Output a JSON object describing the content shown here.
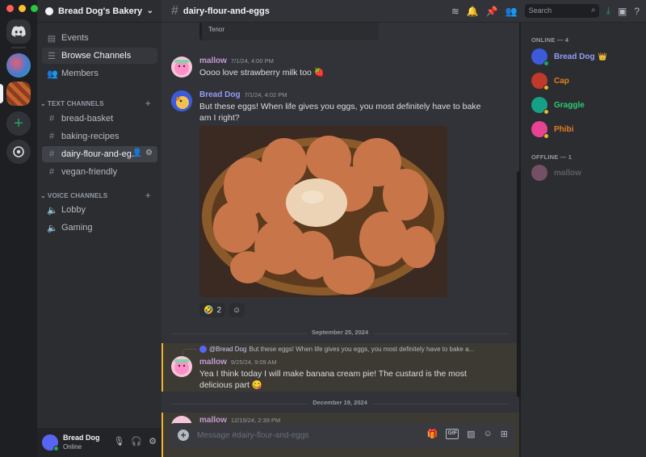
{
  "server": {
    "name": "Bread Dog's Bakery"
  },
  "sidebar": {
    "top_items": [
      {
        "label": "Events",
        "icon": "calendar-icon"
      },
      {
        "label": "Browse Channels",
        "icon": "browse-channels-icon"
      },
      {
        "label": "Members",
        "icon": "members-icon"
      }
    ],
    "text_category": "TEXT CHANNELS",
    "text_channels": [
      {
        "label": "bread-basket"
      },
      {
        "label": "baking-recipes"
      },
      {
        "label": "dairy-flour-and-eg..."
      },
      {
        "label": "vegan-friendly"
      }
    ],
    "voice_category": "VOICE CHANNELS",
    "voice_channels": [
      {
        "label": "Lobby"
      },
      {
        "label": "Gaming"
      }
    ]
  },
  "user": {
    "name": "Bread Dog",
    "status": "Online"
  },
  "topbar": {
    "channel": "dairy-flour-and-eggs",
    "search_placeholder": "Search"
  },
  "messages": {
    "embed_label": "Tenor",
    "m1": {
      "author": "mallow",
      "time": "7/1/24, 4:00 PM",
      "text": "Oooo love strawberry milk too 🍓"
    },
    "m2": {
      "author": "Bread Dog",
      "time": "7/1/24, 4:02 PM",
      "text": "But these eggs! When life gives you eggs, you most definitely have to bake am I right?"
    },
    "m2_reaction": {
      "emoji": "🤣",
      "count": "2"
    },
    "divider1": "September 25, 2024",
    "reply": {
      "mention": "@Bread Dog",
      "text": "But these eggs! When life gives you eggs, you most definitely have to bake a..."
    },
    "m3": {
      "author": "mallow",
      "time": "9/25/24, 9:09 AM",
      "text": "Yea I think today I will make banana cream pie! The custard is the most delicious part 😋"
    },
    "divider2": "December 19, 2024",
    "m4": {
      "author": "mallow",
      "time": "12/19/24, 2:39 PM"
    }
  },
  "composer": {
    "placeholder": "Message #dairy-flour-and-eggs"
  },
  "member_list": {
    "online_header": "ONLINE — 4",
    "online": [
      {
        "name": "Bread Dog",
        "color": "#949cf7",
        "badge": "👑"
      },
      {
        "name": "Cap",
        "color": "#e67e22"
      },
      {
        "name": "Graggle",
        "color": "#2ecc71"
      },
      {
        "name": "Phibi",
        "color": "#e67e22"
      }
    ],
    "offline_header": "OFFLINE — 1",
    "offline": [
      {
        "name": "mallow",
        "color": "#b5bac1"
      }
    ]
  },
  "colors": {
    "accent": "#5865f2",
    "online": "#23a55a",
    "mallow": "#c39bd3",
    "bread_dog": "#949cf7",
    "highlight": "#f0b232"
  }
}
